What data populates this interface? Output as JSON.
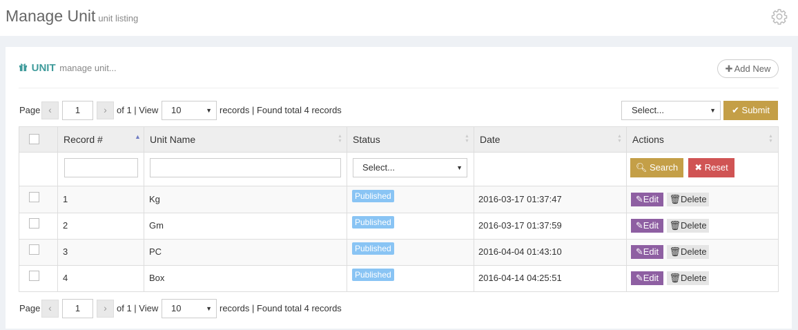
{
  "header": {
    "title": "Manage Unit",
    "subtitle": "unit listing",
    "settings_icon": "gear-icon"
  },
  "portlet": {
    "icon": "gift-icon",
    "title": "UNIT",
    "subtitle": "manage unit...",
    "add_new_label": "Add New"
  },
  "pager": {
    "page_label": "Page",
    "prev": "‹",
    "next": "›",
    "current_page": "1",
    "of_view_text": "of 1 | View",
    "page_size": "10",
    "records_text": "records | Found total 4 records"
  },
  "bulk": {
    "select_value": "Select...",
    "submit_label": "Submit"
  },
  "table": {
    "columns": [
      "Record #",
      "Unit Name",
      "Status",
      "Date",
      "Actions"
    ],
    "sorted_column": "Record #",
    "filters": {
      "status_select": "Select...",
      "search_label": "Search",
      "reset_label": "Reset"
    },
    "rows": [
      {
        "record": "1",
        "name": "Kg",
        "status": "Published",
        "date": "2016-03-17 01:37:47"
      },
      {
        "record": "2",
        "name": "Gm",
        "status": "Published",
        "date": "2016-03-17 01:37:59"
      },
      {
        "record": "3",
        "name": "PC",
        "status": "Published",
        "date": "2016-04-04 01:43:10"
      },
      {
        "record": "4",
        "name": "Box",
        "status": "Published",
        "date": "2016-04-14 04:25:51"
      }
    ],
    "row_actions": {
      "edit_label": "Edit",
      "delete_label": "Delete"
    }
  },
  "colors": {
    "accent_teal": "#3f9b9b",
    "submit_gold": "#c49f47",
    "reset_red": "#d05454",
    "edit_purple": "#8e5fa2",
    "published_badge": "#89c4f4",
    "sort_active": "#6f7cc3"
  }
}
